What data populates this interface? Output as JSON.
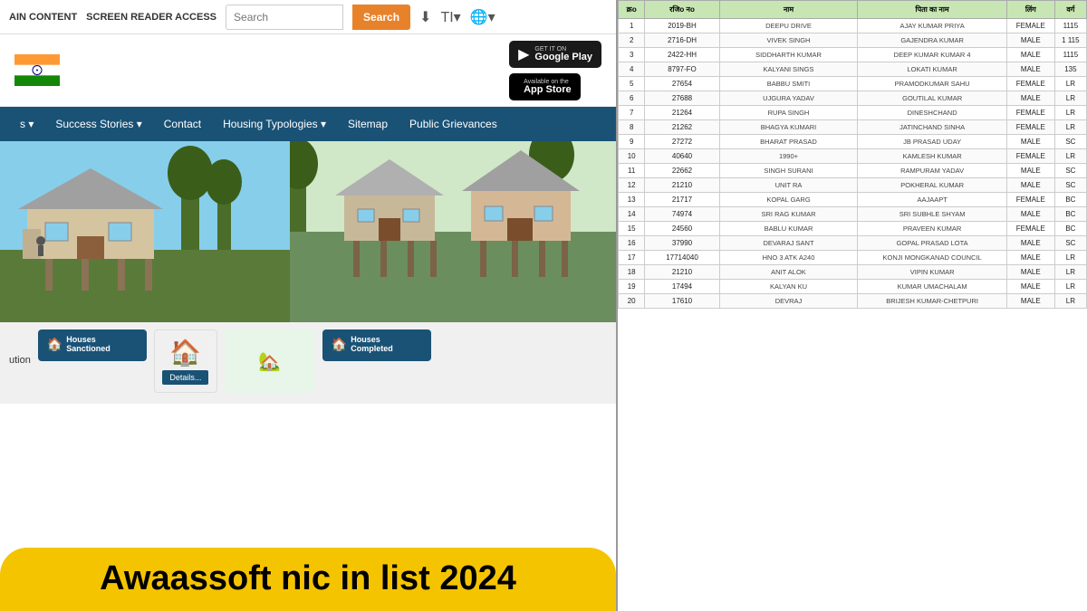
{
  "left": {
    "topNav": {
      "link1": "AIN CONTENT",
      "link2": "SCREEN READER ACCESS",
      "searchPlaceholder": "Search",
      "searchBtn": "Search"
    },
    "appBadges": {
      "googlePlayLabel": "GET IT ON",
      "googlePlayStore": "Google Play",
      "appStoreLabel": "Available on the",
      "appStore": "App Store"
    },
    "mainNav": {
      "items": [
        {
          "label": "s ▾",
          "hasArrow": true
        },
        {
          "label": "Success Stories ▾",
          "hasArrow": true
        },
        {
          "label": "Contact",
          "hasArrow": false
        },
        {
          "label": "Housing Typologies ▾",
          "hasArrow": true
        },
        {
          "label": "Sitemap",
          "hasArrow": false
        },
        {
          "label": "Public Grievances",
          "hasArrow": false
        }
      ]
    },
    "solutionLabel": "ution",
    "cards": [
      {
        "label": "Houses Sanctioned",
        "color": "blue"
      },
      {
        "label": "Houses Completed",
        "color": "blue"
      }
    ],
    "detailsBtn": "Details..."
  },
  "banner": {
    "text": "Awaassoft nic in list 2024"
  },
  "table": {
    "headers": [
      "क्रo",
      "रजिo नo",
      "नाम",
      "पिता का नाम",
      "लिंग",
      "वर्ग"
    ],
    "rows": [
      [
        "1",
        "2019-BH",
        "DEEPU DRIVE",
        "AJAY KUMAR PRIYA",
        "FEMALE",
        "1115"
      ],
      [
        "2",
        "2716-DH",
        "VIVEK SINGH",
        "GAJENDRA KUMAR",
        "MALE",
        "1 115"
      ],
      [
        "3",
        "2422-HH",
        "SIDDHARTH KUMAR",
        "DEEP KUMAR KUMAR 4",
        "MALE",
        "1115"
      ],
      [
        "4",
        "8797-FO",
        "KALYANI SINGS",
        "LOKATI KUMAR",
        "MALE",
        "135"
      ],
      [
        "5",
        "27654",
        "BABBU SMITI",
        "PRAMODKUMAR SAHU",
        "FEMALE",
        "LR"
      ],
      [
        "6",
        "27688",
        "UJGURA YADAV",
        "GOUTILAL KUMAR",
        "MALE",
        "LR"
      ],
      [
        "7",
        "21264",
        "RUPA SINGH",
        "DINESHCHAND",
        "FEMALE",
        "LR"
      ],
      [
        "8",
        "21262",
        "BHAGYA KUMARI",
        "JATINCHAND SINHA",
        "FEMALE",
        "LR"
      ],
      [
        "9",
        "27272",
        "BHARAT PRASAD",
        "JB PRASAD UDAY",
        "MALE",
        "SC"
      ],
      [
        "10",
        "40640",
        "1990+",
        "KAMLESH KUMAR",
        "FEMALE",
        "LR"
      ],
      [
        "11",
        "22662",
        "SINGH SURANI",
        "RAMPURAM YADAV",
        "MALE",
        "SC"
      ],
      [
        "12",
        "21210",
        "UNIT RA",
        "POKHERAL KUMAR",
        "MALE",
        "SC"
      ],
      [
        "13",
        "21717",
        "KOPAL GARG",
        "AAJAAPT",
        "FEMALE",
        "BC"
      ],
      [
        "14",
        "74974",
        "SRI RAG KUMAR",
        "SRI SUBHLE SHYAM",
        "MALE",
        "BC"
      ],
      [
        "15",
        "24560",
        "BABLU KUMAR",
        "PRAVEEN KUMAR",
        "FEMALE",
        "BC"
      ],
      [
        "16",
        "37990",
        "DEVARAJ SANT",
        "GOPAL PRASAD LOTA",
        "MALE",
        "SC"
      ],
      [
        "17",
        "17714040",
        "HNO 3 ATK A240",
        "KONJI MONGKANAD COUNCIL",
        "MALE",
        "LR"
      ],
      [
        "18",
        "21210",
        "ANIT ALOK",
        "VIPIN KUMAR",
        "MALE",
        "LR"
      ],
      [
        "19",
        "17494",
        "KALYAN KU",
        "KUMAR UMACHALAM",
        "MALE",
        "LR"
      ],
      [
        "20",
        "17610",
        "DEVRAJ",
        "BRIJESH KUMAR-CHETPURI",
        "MALE",
        "LR"
      ]
    ]
  }
}
